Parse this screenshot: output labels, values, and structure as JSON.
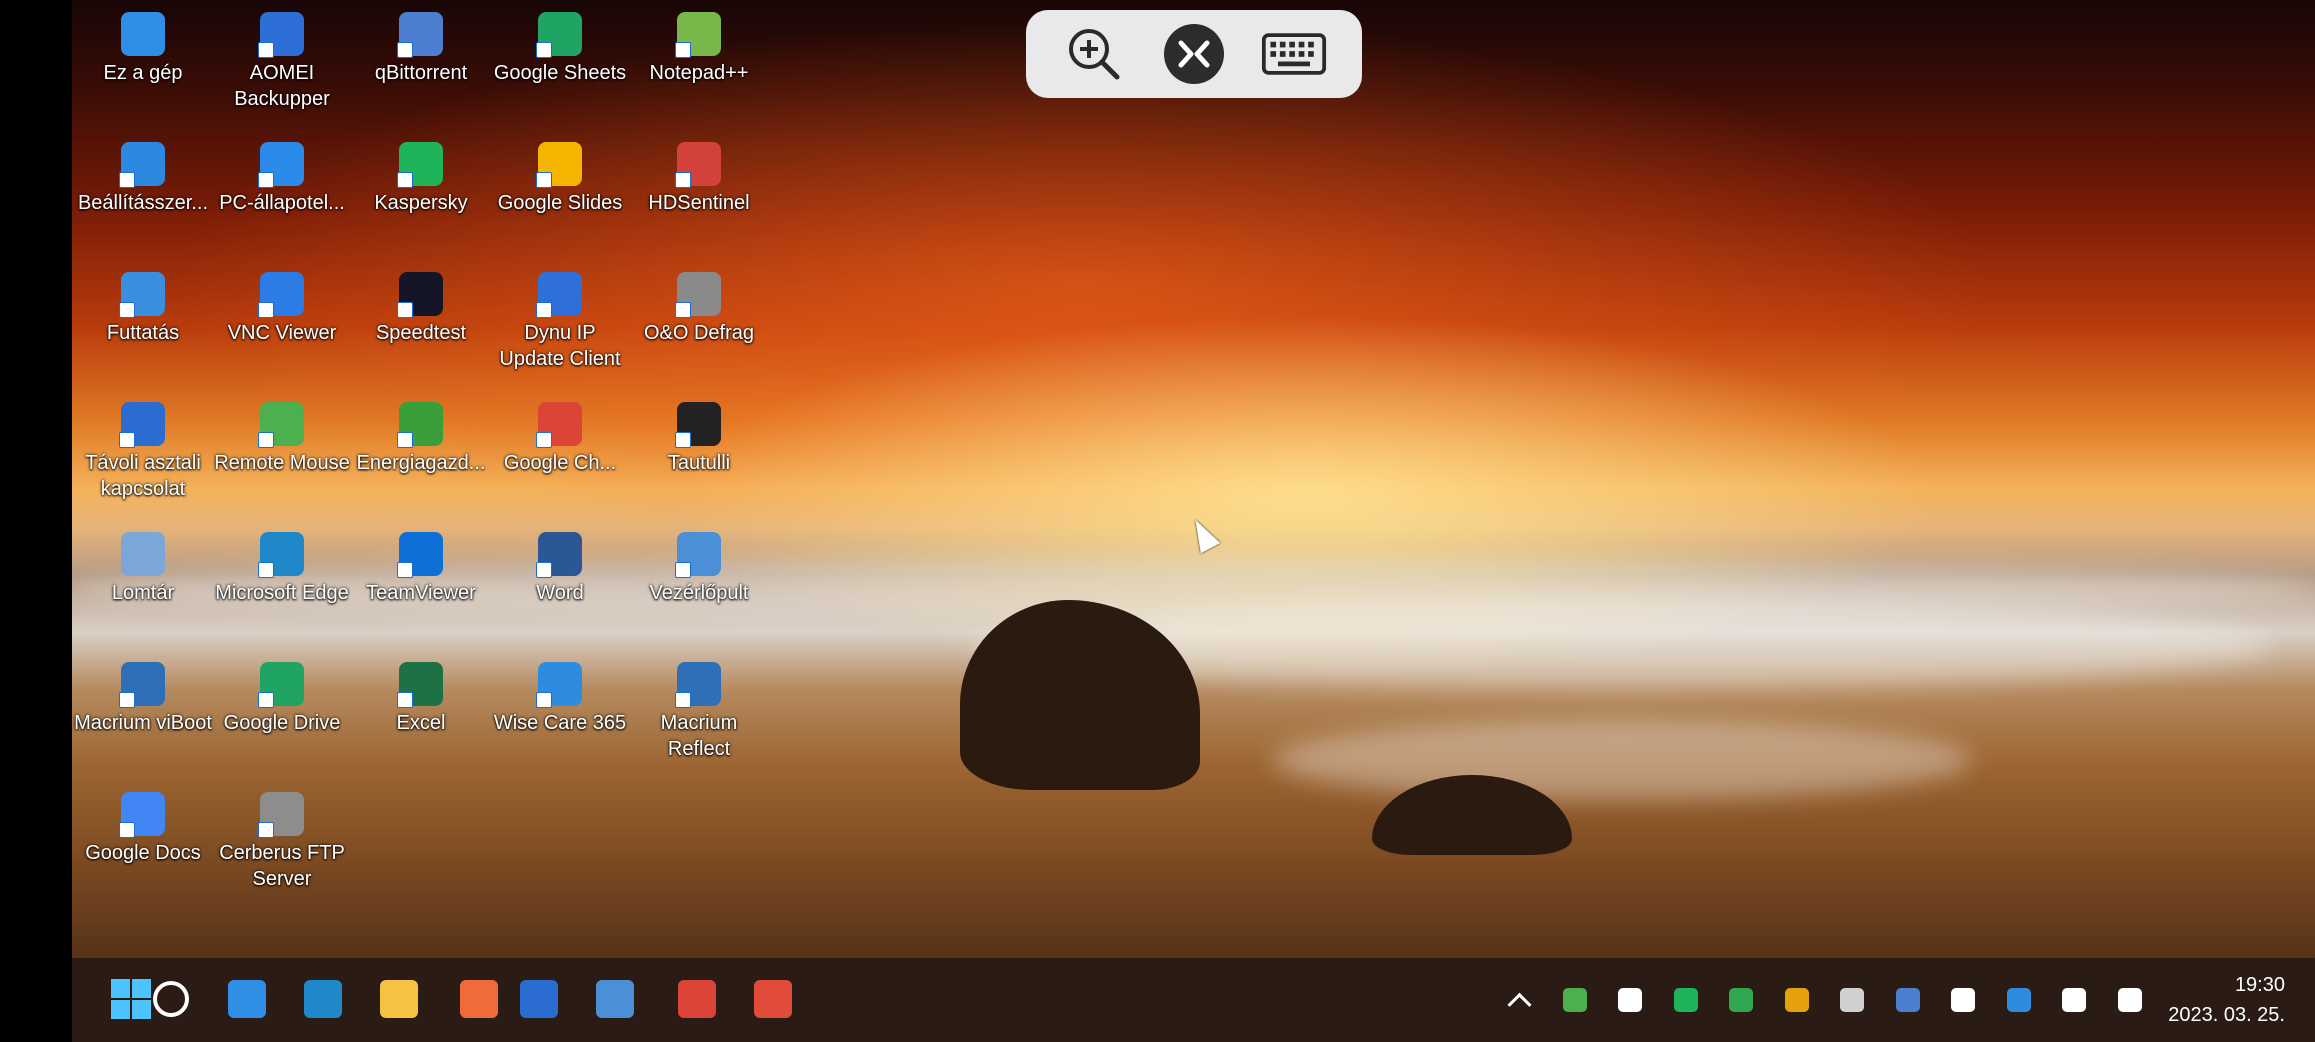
{
  "toolbar": {
    "zoom_icon": "zoom-in-icon",
    "remote_icon": "remote-connect-icon",
    "keyboard_icon": "keyboard-icon"
  },
  "desktop_icons": [
    {
      "label": "Ez a gép",
      "icon": "monitor-icon",
      "color": "#2f8fe6"
    },
    {
      "label": "AOMEI Backupper",
      "icon": "aomei-backupper-icon",
      "color": "#2d6fd6"
    },
    {
      "label": "qBittorrent",
      "icon": "qbittorrent-icon",
      "color": "#4d7fd1"
    },
    {
      "label": "Google Sheets",
      "icon": "google-sheets-icon",
      "color": "#1fa463"
    },
    {
      "label": "Notepad++",
      "icon": "notepadpp-icon",
      "color": "#78b84a"
    },
    {
      "label": "Beállításszer...",
      "icon": "settings-editor-icon",
      "color": "#2b8ae0"
    },
    {
      "label": "PC-állapotel...",
      "icon": "pc-health-icon",
      "color": "#2a8be8"
    },
    {
      "label": "Kaspersky",
      "icon": "kaspersky-icon",
      "color": "#1fb35a"
    },
    {
      "label": "Google Slides",
      "icon": "google-slides-icon",
      "color": "#f4b400"
    },
    {
      "label": "HDSentinel",
      "icon": "hdsentinel-icon",
      "color": "#d2423a"
    },
    {
      "label": "Futtatás",
      "icon": "run-icon",
      "color": "#3b8fe0"
    },
    {
      "label": "VNC Viewer",
      "icon": "vnc-viewer-icon",
      "color": "#2d7be5"
    },
    {
      "label": "Speedtest",
      "icon": "speedtest-icon",
      "color": "#141526"
    },
    {
      "label": "Dynu IP Update Client",
      "icon": "dynu-icon",
      "color": "#2f6fd8"
    },
    {
      "label": "O&O Defrag",
      "icon": "oo-defrag-icon",
      "color": "#8a8a8a"
    },
    {
      "label": "Távoli asztali kapcsolat",
      "icon": "remote-desktop-icon",
      "color": "#2b6cd1"
    },
    {
      "label": "Remote Mouse",
      "icon": "remote-mouse-icon",
      "color": "#4caf50"
    },
    {
      "label": "Energiagazd...",
      "icon": "energy-icon",
      "color": "#3a9f3a"
    },
    {
      "label": "Google Ch...",
      "icon": "chrome-icon",
      "color": "#db4437"
    },
    {
      "label": "Tautulli",
      "icon": "tautulli-icon",
      "color": "#222222"
    },
    {
      "label": "Lomtár",
      "icon": "recycle-bin-icon",
      "color": "#7aa7d6"
    },
    {
      "label": "Microsoft Edge",
      "icon": "edge-icon",
      "color": "#1e88c9"
    },
    {
      "label": "TeamViewer",
      "icon": "teamviewer-icon",
      "color": "#0e6fd8"
    },
    {
      "label": "Word",
      "icon": "word-icon",
      "color": "#2b5797"
    },
    {
      "label": "Vezérlőpult",
      "icon": "control-panel-icon",
      "color": "#4b8fd6"
    },
    {
      "label": "Macrium viBoot",
      "icon": "macrium-viboot-icon",
      "color": "#2f6fb8"
    },
    {
      "label": "Google Drive",
      "icon": "google-drive-icon",
      "color": "#1fa463"
    },
    {
      "label": "Excel",
      "icon": "excel-icon",
      "color": "#1e7145"
    },
    {
      "label": "Wise Care 365",
      "icon": "wise-care-icon",
      "color": "#2d8be0"
    },
    {
      "label": "Macrium Reflect",
      "icon": "macrium-reflect-icon",
      "color": "#2f6fb8"
    },
    {
      "label": "Google Docs",
      "icon": "google-docs-icon",
      "color": "#4285f4"
    },
    {
      "label": "Cerberus FTP Server",
      "icon": "cerberus-ftp-icon",
      "color": "#8d8d8d"
    }
  ],
  "taskbar": {
    "start_icon": "windows-start-icon",
    "pinned": [
      {
        "icon": "search-icon",
        "color": "#ffffff"
      },
      {
        "icon": "remote-desktop-taskbar-icon",
        "color": "#2f8fe6"
      },
      {
        "icon": "edge-icon",
        "color": "#1e88c9"
      },
      {
        "icon": "file-explorer-icon",
        "color": "#f5c242"
      },
      {
        "icon": "store-icon",
        "color": "#ef6c3a"
      },
      {
        "icon": "remote-desktop-icon",
        "color": "#2b6cd1"
      },
      {
        "icon": "control-panel-icon",
        "color": "#4b8fd6"
      },
      {
        "icon": "chrome-icon",
        "color": "#db4437"
      },
      {
        "icon": "snipping-tool-icon",
        "color": "#e04b3a"
      }
    ],
    "tray": [
      {
        "icon": "chevron-up-icon",
        "color": "#ffffff"
      },
      {
        "icon": "energy-tray-icon",
        "color": "#4caf50"
      },
      {
        "icon": "teamviewer-tray-icon",
        "color": "#ffffff"
      },
      {
        "icon": "kaspersky-tray-icon",
        "color": "#1fb35a"
      },
      {
        "icon": "green-arrow-tray-icon",
        "color": "#2fa84f"
      },
      {
        "icon": "tautulli-tray-icon",
        "color": "#e5a00d"
      },
      {
        "icon": "network-monitor-tray-icon",
        "color": "#d0d0d0"
      },
      {
        "icon": "qbittorrent-tray-icon",
        "color": "#4d7fd1"
      },
      {
        "icon": "usb-tray-icon",
        "color": "#ffffff"
      },
      {
        "icon": "defender-tray-icon",
        "color": "#2d8be0"
      },
      {
        "icon": "network-tray-icon",
        "color": "#ffffff"
      },
      {
        "icon": "volume-icon",
        "color": "#ffffff"
      }
    ],
    "time": "19:30",
    "date": "2023. 03. 25."
  }
}
